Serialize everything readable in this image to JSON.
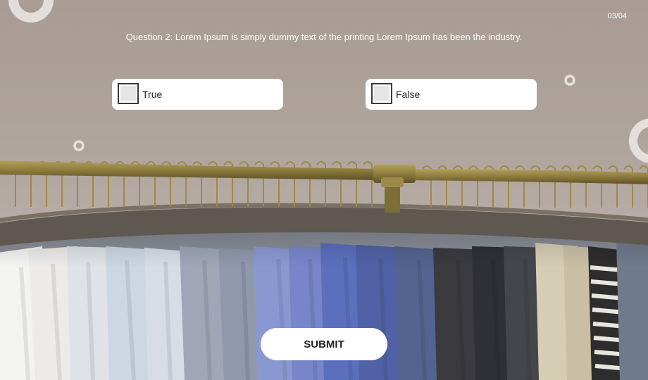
{
  "quiz": {
    "counter": "03/04",
    "question": "Question 2: Lorem Ipsum is simply dummy text of the printing Lorem Ipsum has been the industry.",
    "options": [
      {
        "label": "True",
        "checked": false
      },
      {
        "label": "False",
        "checked": false
      }
    ],
    "submit_label": "SUBMIT"
  },
  "colors": {
    "wall": "#aea39b",
    "rail": "#8a7a40",
    "button_bg": "#ffffff",
    "text_on_bg": "#ffffff"
  }
}
